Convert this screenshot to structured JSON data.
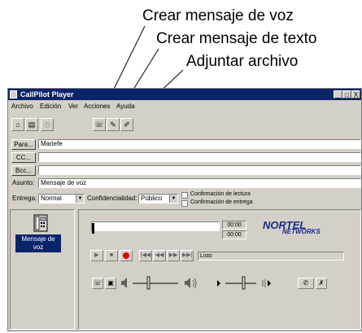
{
  "callouts": [
    "Crear mensaje de voz",
    "Crear mensaje de texto",
    "Adjuntar archivo"
  ],
  "window": {
    "title": "CallPilot Player",
    "controls": {
      "minimize": "_",
      "maximize": "□",
      "close": "X"
    }
  },
  "menu": [
    "Archivo",
    "Edición",
    "Ver",
    "Acciones",
    "Ayuda"
  ],
  "toolbar": [
    {
      "icon": "home-icon",
      "glyph": "⌂"
    },
    {
      "icon": "save-icon",
      "glyph": "▤"
    },
    {
      "icon": "print-icon",
      "glyph": "⎙"
    },
    {
      "icon": "voice-message-icon",
      "glyph": "☏"
    },
    {
      "icon": "text-message-icon",
      "glyph": "✎"
    },
    {
      "icon": "attach-file-icon",
      "glyph": "✐"
    }
  ],
  "address": {
    "to_button": "Para...",
    "to_value": "Mariefe",
    "cc_button": "CC...",
    "cc_value": "",
    "bcc_button": "Bcc...",
    "bcc_value": "",
    "subject_label": "Asunto:",
    "subject_value": "Mensaje de voz"
  },
  "options": {
    "delivery_label": "Entrega:",
    "delivery_value": "Normal",
    "privacy_label": "Confidencialidad:",
    "privacy_value": "Público",
    "read_receipt": "Confirmación de lectura",
    "delivery_receipt": "Confirmación de entrega",
    "read_receipt_checked": false,
    "delivery_receipt_checked": false
  },
  "attachments": [
    {
      "label": "Mensaje de voz",
      "icon": "phone-icon"
    }
  ],
  "player": {
    "position_time": "00:00",
    "length_time": "00:00",
    "status": "Listo",
    "progress": 0,
    "playback_volume": 0.35,
    "record_volume": 0.6,
    "logo_top": "NORTEL",
    "logo_bottom": "NETWORKS",
    "colors": {
      "record": "#e00000",
      "selection": "#0a246a",
      "titlebar": "#0a246a",
      "logo": "#1a2a8a"
    }
  }
}
